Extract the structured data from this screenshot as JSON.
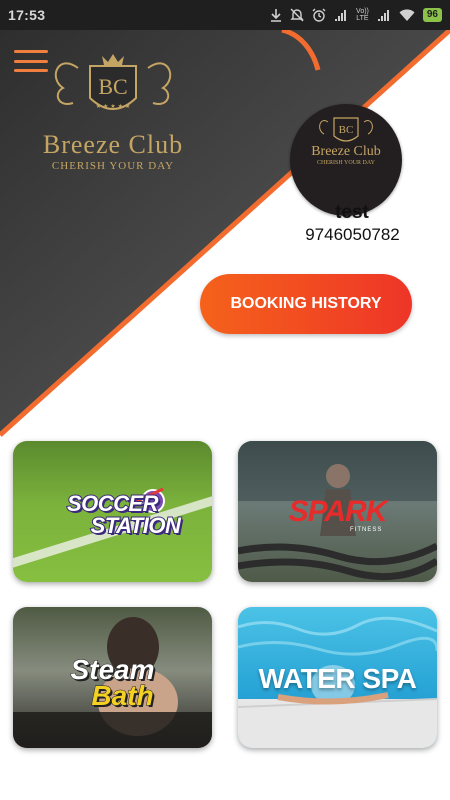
{
  "status_bar": {
    "time": "17:53",
    "network_label_top": "Vo))",
    "network_label_bottom": "LTE",
    "battery": "96"
  },
  "brand": {
    "name": "Breeze Club",
    "tagline": "CHERISH YOUR DAY",
    "monogram": "BC"
  },
  "profile": {
    "avatar_name": "Breeze Club",
    "avatar_tagline": "CHERISH YOUR DAY",
    "user_name": "test",
    "phone": "9746050782"
  },
  "actions": {
    "booking_history_label": "BOOKING HISTORY"
  },
  "services": [
    {
      "title_line1": "SOCCER",
      "title_line2": "STATION"
    },
    {
      "title": "SPARK",
      "subtitle": "FITNESS"
    },
    {
      "title_line1": "Steam",
      "title_line2": "Bath"
    },
    {
      "title": "WATER SPA"
    }
  ],
  "colors": {
    "accent_orange": "#f5621b",
    "accent_red": "#ee3528",
    "hero_dark": "#3a3a3a",
    "gold": "#c5a564"
  }
}
